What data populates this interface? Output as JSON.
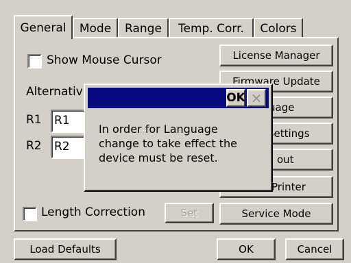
{
  "tabs": [
    "General",
    "Mode",
    "Range",
    "Temp. Corr.",
    "Colors"
  ],
  "active_tab": "General",
  "general": {
    "show_mouse_cursor_label": "Show Mouse Cursor",
    "show_mouse_cursor_checked": false,
    "alternative_label": "Alternativ",
    "r1_label": "R1",
    "r1_value": "R1",
    "r2_label": "R2",
    "r2_value": "R2",
    "length_correction_label": "Length Correction",
    "length_correction_checked": false,
    "set_button": "Set"
  },
  "right_buttons": {
    "license_manager": "License Manager",
    "firmware_update": "Firmware Update",
    "language": "uage",
    "settings": "Settings",
    "about": "out",
    "printer": "Printer",
    "service_mode": "Service Mode"
  },
  "bottom": {
    "load_defaults": "Load Defaults",
    "ok": "OK",
    "cancel": "Cancel"
  },
  "dialog": {
    "ok_button": "OK",
    "close_button": "×",
    "message_lines": [
      "In order for Language",
      "change to take effect the",
      "device must be reset."
    ]
  }
}
